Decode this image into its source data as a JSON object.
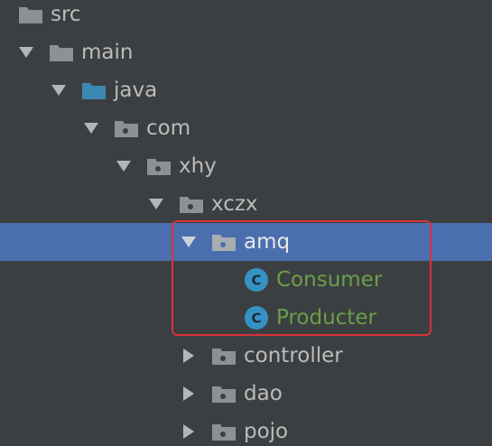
{
  "tree": {
    "nodes": [
      {
        "label": "src",
        "icon": "folder-icon",
        "arrow": "none",
        "selected": false
      },
      {
        "label": "main",
        "icon": "folder-icon",
        "arrow": "expanded",
        "selected": false
      },
      {
        "label": "java",
        "icon": "source-root-folder-icon",
        "arrow": "expanded",
        "selected": false
      },
      {
        "label": "com",
        "icon": "package-icon",
        "arrow": "expanded",
        "selected": false
      },
      {
        "label": "xhy",
        "icon": "package-icon",
        "arrow": "expanded",
        "selected": false
      },
      {
        "label": "xczx",
        "icon": "package-icon",
        "arrow": "expanded",
        "selected": false
      },
      {
        "label": "amq",
        "icon": "package-icon",
        "arrow": "expanded",
        "selected": true
      },
      {
        "label": "Consumer",
        "icon": "java-class-icon",
        "arrow": "none",
        "selected": false
      },
      {
        "label": "Producter",
        "icon": "java-class-icon",
        "arrow": "none",
        "selected": false
      },
      {
        "label": "controller",
        "icon": "package-icon",
        "arrow": "collapsed",
        "selected": false
      },
      {
        "label": "dao",
        "icon": "package-icon",
        "arrow": "collapsed",
        "selected": false
      },
      {
        "label": "pojo",
        "icon": "package-icon",
        "arrow": "collapsed",
        "selected": false
      }
    ],
    "class_icon_letter": "C"
  },
  "colors": {
    "background": "#3c3f41",
    "selection": "#4b6eaf",
    "text": "#bbbbbb",
    "class_text": "#6a9f4a",
    "folder": "#8c9196",
    "source_root_folder": "#3d87b3",
    "class_icon": "#3592c4",
    "highlight_border": "#d9323a"
  }
}
